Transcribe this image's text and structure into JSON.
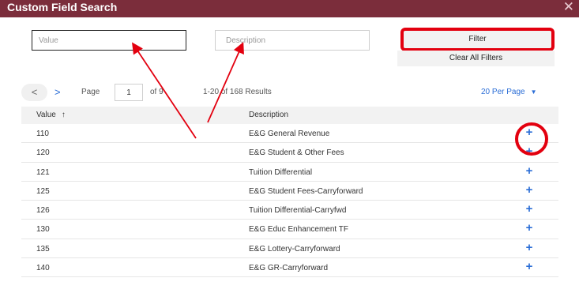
{
  "dialog": {
    "title": "Custom Field Search",
    "close_glyph": "✕"
  },
  "filters": {
    "value_placeholder": "Value",
    "description_placeholder": "Description",
    "filter_label": "Filter",
    "clear_label": "Clear All Filters"
  },
  "pagination": {
    "prev_glyph": "<",
    "next_glyph": ">",
    "page_label": "Page",
    "page_value": "1",
    "of_label": "of 9",
    "results_label": "1-20 of 168 Results",
    "per_page_label": "20 Per Page",
    "per_page_caret": "▼"
  },
  "table": {
    "value_header": "Value",
    "sort_glyph": "↑",
    "description_header": "Description",
    "add_glyph": "+",
    "rows": [
      {
        "value": "110",
        "description": "E&G General Revenue"
      },
      {
        "value": "120",
        "description": "E&G Student & Other Fees"
      },
      {
        "value": "121",
        "description": "Tuition Differential"
      },
      {
        "value": "125",
        "description": "E&G Student Fees-Carryforward"
      },
      {
        "value": "126",
        "description": "Tuition Differential-Carryfwd"
      },
      {
        "value": "130",
        "description": "E&G Educ Enhancement TF"
      },
      {
        "value": "135",
        "description": "E&G Lottery-Carryforward"
      },
      {
        "value": "140",
        "description": "E&G GR-Carryforward"
      }
    ]
  },
  "colors": {
    "title_bar": "#7b2d3b",
    "highlight": "#e3000f",
    "link_blue": "#2a6dd6"
  }
}
